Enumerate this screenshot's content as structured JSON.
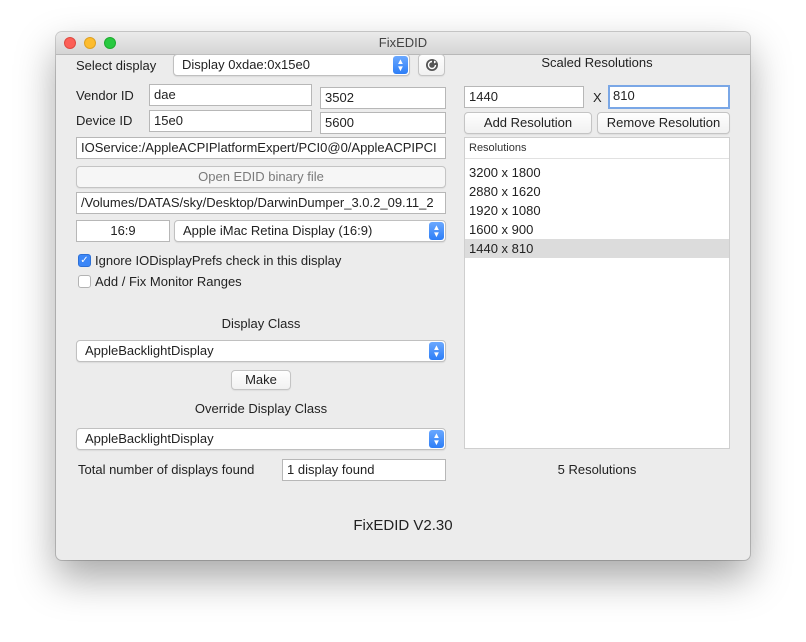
{
  "window": {
    "title": "FixEDID"
  },
  "left": {
    "select_display_label": "Select display",
    "select_display_value": "Display 0xdae:0x15e0",
    "vendor_id_label": "Vendor ID",
    "vendor_id_value": "dae",
    "vendor_id_dec": "3502",
    "device_id_label": "Device ID",
    "device_id_value": "15e0",
    "device_id_dec": "5600",
    "ioservice_path": "IOService:/AppleACPIPlatformExpert/PCI0@0/AppleACPIPCI",
    "open_edid_button": "Open EDID binary file",
    "edid_path": "/Volumes/DATAS/sky/Desktop/DarwinDumper_3.0.2_09.11_2",
    "aspect_value": "16:9",
    "display_model_value": "Apple iMac Retina Display (16:9)",
    "ignore_prefs_label": "Ignore IODisplayPrefs check in this display",
    "ignore_prefs_checked": true,
    "monitor_ranges_label": "Add / Fix Monitor Ranges",
    "monitor_ranges_checked": false,
    "display_class_label": "Display Class",
    "display_class_value": "AppleBacklightDisplay",
    "make_button": "Make",
    "override_class_label": "Override Display Class",
    "override_class_value": "AppleBacklightDisplay",
    "total_label": "Total number of displays found",
    "total_value": "1 display found"
  },
  "right": {
    "title": "Scaled Resolutions",
    "width_value": "1440",
    "x_label": "X",
    "height_value": "810",
    "add_button": "Add Resolution",
    "remove_button": "Remove Resolution",
    "list_header": "Resolutions",
    "resolutions": [
      "3200 x 1800",
      "2880 x 1620",
      "1920 x 1080",
      "1600 x 900",
      "1440 x 810"
    ],
    "selected_index": 4,
    "count_label": "5 Resolutions"
  },
  "footer": {
    "version": "FixEDID V2.30"
  },
  "icons": {
    "refresh": "refresh-icon",
    "checkmark": "checkmark-icon",
    "popup_arrows": "chevron-updown-icon"
  },
  "colors": {
    "accent": "#2d7ef7",
    "window_bg": "#ececec",
    "selection": "#dcdcdc"
  }
}
